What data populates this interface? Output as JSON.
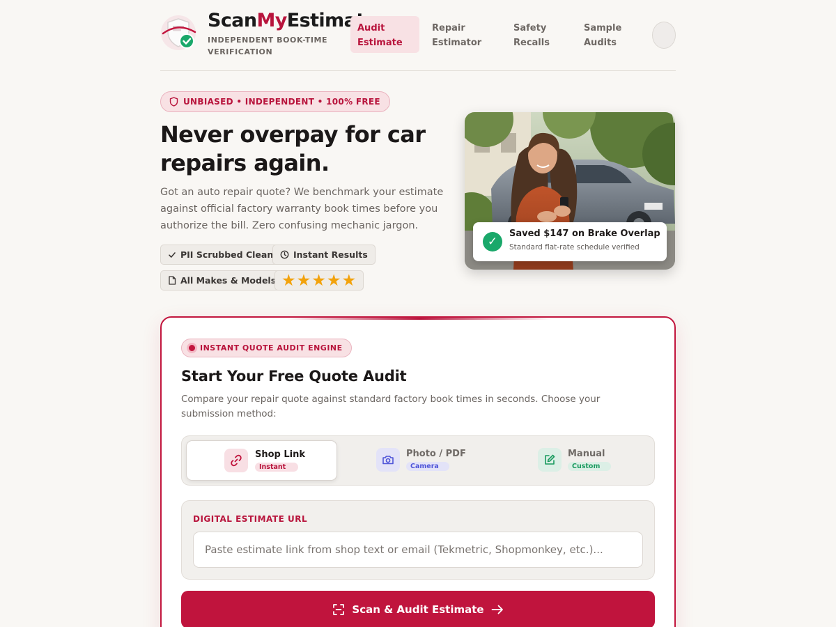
{
  "brand": {
    "name_part1": "Scan",
    "name_part2": "My",
    "name_part3": "Estimate",
    "tagline": "INDEPENDENT BOOK-TIME VERIFICATION"
  },
  "nav": {
    "items": [
      {
        "label": "Audit Estimate",
        "active": true
      },
      {
        "label": "Repair Estimator",
        "active": false
      },
      {
        "label": "Safety Recalls",
        "active": false
      },
      {
        "label": "Sample Audits",
        "active": false
      }
    ]
  },
  "hero": {
    "pill": "UNBIASED • INDEPENDENT • 100% FREE",
    "title": "Never overpay for car repairs again.",
    "description": "Got an auto repair quote? We benchmark your estimate against official factory warranty book times before you authorize the bill. Zero confusing mechanic jargon.",
    "chips": {
      "pii": "PII Scrubbed Clean",
      "instant": "Instant Results",
      "makes": "All Makes & Models",
      "stars": "★★★★★"
    }
  },
  "photo_card": {
    "title": "Saved $147 on Brake Overlap",
    "subtitle": "Standard flat-rate schedule verified",
    "check_glyph": "✓"
  },
  "audit": {
    "badge": "INSTANT QUOTE AUDIT ENGINE",
    "title": "Start Your Free Quote Audit",
    "description": "Compare your repair quote against standard factory book times in seconds. Choose your submission method:",
    "tabs": [
      {
        "label": "Shop Link",
        "badge": "Instant",
        "icon": "link-icon",
        "active": true
      },
      {
        "label": "Photo / PDF",
        "badge": "Camera",
        "icon": "camera-icon",
        "active": false
      },
      {
        "label": "Manual",
        "badge": "Custom",
        "icon": "edit-icon",
        "active": false
      }
    ],
    "url_label": "DIGITAL ESTIMATE URL",
    "url_value": "",
    "url_placeholder": "Paste estimate link from shop text or email (Tekmetric, Shopmonkey, etc.)...",
    "button_label": "Scan & Audit Estimate"
  },
  "colors": {
    "accent": "#c0143d",
    "accent_soft": "#f8e1e4",
    "background": "#f9f7f4",
    "success": "#1aa86a",
    "stars": "#f2a20c"
  }
}
